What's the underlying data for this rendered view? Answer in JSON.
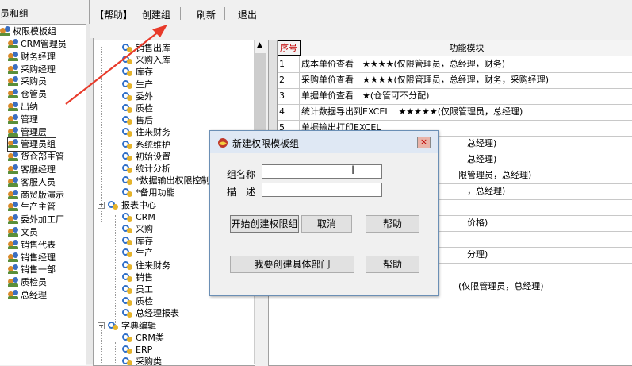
{
  "left_panel": {
    "title": "员和组",
    "root": "权限模板组",
    "items": [
      "CRM管理员",
      "财务经理",
      "采购经理",
      "采购员",
      "仓管员",
      "出纳",
      "管理",
      "管理层",
      "管理员组",
      "货仓部主管",
      "客服经理",
      "客服人员",
      "商贸版演示",
      "生产主管",
      "委外加工厂",
      "文员",
      "销售代表",
      "销售经理",
      "销售一部",
      "质检员",
      "总经理"
    ]
  },
  "toolbar": {
    "help": "【帮助】",
    "create_group": "创建组",
    "refresh": "刷新",
    "exit": "退出"
  },
  "mid_tree": {
    "items_top": [
      "销售出库",
      "采购入库",
      "库存",
      "生产",
      "委外",
      "质检",
      "售后",
      "往来财务",
      "系统维护",
      "初始设置",
      "统计分析",
      "*数据输出权限控制",
      "*备用功能"
    ],
    "report_center": "报表中心",
    "report_items": [
      "CRM",
      "采购",
      "库存",
      "生产",
      "往来财务",
      "销售",
      "员工",
      "质检",
      "总经理报表"
    ],
    "dict_edit": "字典编辑",
    "dict_items": [
      "CRM类",
      "ERP",
      "采购类"
    ]
  },
  "grid": {
    "col_index": "序号",
    "col_module": "功能模块",
    "rows": [
      {
        "no": "1",
        "text": "成本单价查看　★★★★(仅限管理员，总经理，财务)"
      },
      {
        "no": "2",
        "text": "采购单价查看　★★★★(仅限管理员，总经理，财务，采购经理)"
      },
      {
        "no": "3",
        "text": "单据单价查看　★(仓管可不分配)"
      },
      {
        "no": "4",
        "text": "统计数据导出到EXCEL　★★★★★(仅限管理员，总经理)"
      },
      {
        "no": "5",
        "text": "单据输出打印EXCEL"
      },
      {
        "no": "",
        "text": "　　　　　　　　　　　　　　　　　　　总经理)"
      },
      {
        "no": "",
        "text": "　　　　　　　　　　　　　　　　　　　总经理)"
      },
      {
        "no": "",
        "text": "　　　　　　　　　　　　　　　　　　限管理员，总经理)"
      },
      {
        "no": "",
        "text": "　　　　　　　　　　　　　　　　　　　，总经理)"
      },
      {
        "no": "",
        "text": ""
      },
      {
        "no": "",
        "text": "　　　　　　　　　　　　　　　　　　　价格)"
      },
      {
        "no": "",
        "text": ""
      },
      {
        "no": "",
        "text": "　　　　　　　　　　　　　　　　　　　分理)"
      },
      {
        "no": "",
        "text": ""
      },
      {
        "no": "",
        "text": "　　　　　　　　　　　　　　　　　　(仅限管理员，总经理)"
      }
    ]
  },
  "dialog": {
    "title": "新建权限模板组",
    "close": "×",
    "group_name_label": "组名称",
    "desc_label": "描　述",
    "group_name_value": "",
    "desc_value": "",
    "btn_start": "开始创建权限组",
    "btn_cancel": "取消",
    "btn_help1": "帮助",
    "btn_dept": "我要创建具体部门",
    "btn_help2": "帮助"
  },
  "colors": {
    "arrow": "#e83a2a",
    "header_red": "#c00000"
  }
}
